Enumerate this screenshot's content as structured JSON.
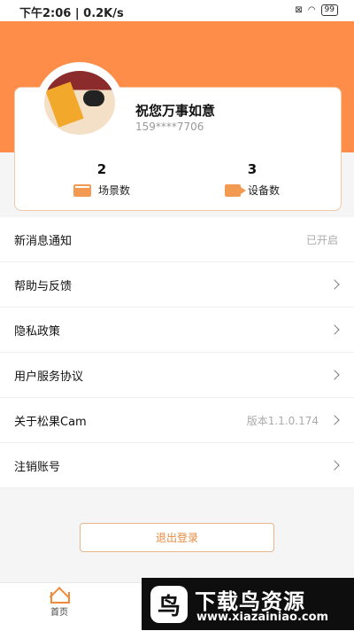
{
  "status_bar": {
    "time": "下午2:06",
    "speed": "0.2K/s",
    "battery": "99"
  },
  "profile": {
    "name": "祝您万事如意",
    "phone": "159****7706"
  },
  "stats": [
    {
      "value": "2",
      "label": "场景数",
      "icon": "scene-icon"
    },
    {
      "value": "3",
      "label": "设备数",
      "icon": "device-icon"
    }
  ],
  "menu": [
    {
      "label": "新消息通知",
      "value": "已开启"
    },
    {
      "label": "帮助与反馈",
      "value": ""
    },
    {
      "label": "隐私政策",
      "value": ""
    },
    {
      "label": "用户服务协议",
      "value": ""
    },
    {
      "label": "关于松果Cam",
      "value": "版本1.1.0.174"
    },
    {
      "label": "注销账号",
      "value": ""
    }
  ],
  "logout_label": "退出登录",
  "bottom_nav": {
    "home_label": "首页"
  },
  "watermark": {
    "title": "下载鸟资源",
    "url": "www.xiazainiao.com"
  },
  "colors": {
    "accent": "#ff8d4a",
    "button_border": "#e7b68b"
  }
}
